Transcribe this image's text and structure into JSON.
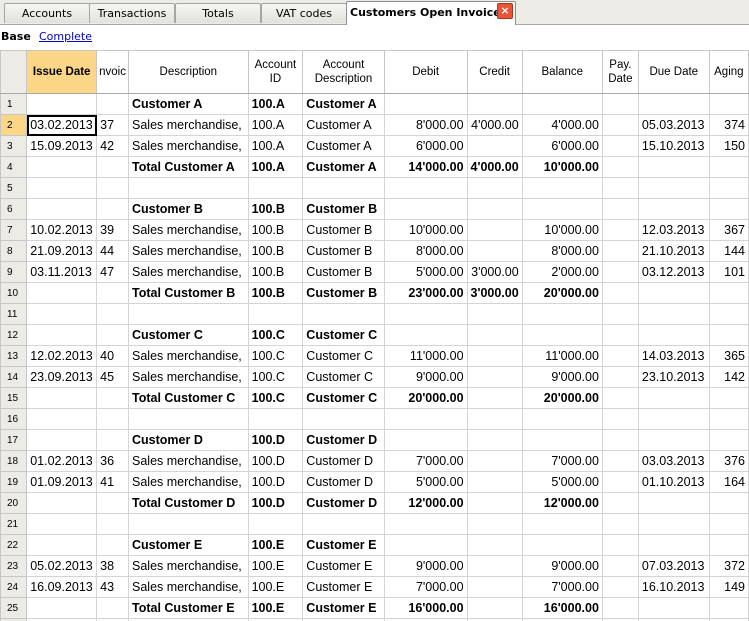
{
  "tabs": [
    {
      "label": "Accounts"
    },
    {
      "label": "Transactions"
    },
    {
      "label": "Totals"
    },
    {
      "label": "VAT codes"
    },
    {
      "label": "Customers Open Invoices",
      "close_glyph": "×"
    }
  ],
  "views": {
    "base": "Base",
    "complete": "Complete"
  },
  "columns": [
    "",
    "Issue Date",
    "nvoic",
    "Description",
    "Account ID",
    "Account Description",
    "Debit",
    "Credit",
    "Balance",
    "Pay. Date",
    "Due Date",
    "Aging"
  ],
  "rows": [
    [
      "1",
      "",
      "",
      "Customer A",
      "100.A",
      "Customer A",
      "",
      "",
      "",
      "",
      "",
      ""
    ],
    [
      "2",
      "03.02.2013",
      "37",
      "Sales merchandise,",
      "100.A",
      "Customer A",
      "8'000.00",
      "4'000.00",
      "4'000.00",
      "",
      "05.03.2013",
      "374"
    ],
    [
      "3",
      "15.09.2013",
      "42",
      "Sales merchandise,",
      "100.A",
      "Customer A",
      "6'000.00",
      "",
      "6'000.00",
      "",
      "15.10.2013",
      "150"
    ],
    [
      "4",
      "",
      "",
      "Total Customer A",
      "100.A",
      "Customer A",
      "14'000.00",
      "4'000.00",
      "10'000.00",
      "",
      "",
      ""
    ],
    [
      "5",
      "",
      "",
      "",
      "",
      "",
      "",
      "",
      "",
      "",
      "",
      ""
    ],
    [
      "6",
      "",
      "",
      "Customer B",
      "100.B",
      "Customer B",
      "",
      "",
      "",
      "",
      "",
      ""
    ],
    [
      "7",
      "10.02.2013",
      "39",
      "Sales merchandise,",
      "100.B",
      "Customer B",
      "10'000.00",
      "",
      "10'000.00",
      "",
      "12.03.2013",
      "367"
    ],
    [
      "8",
      "21.09.2013",
      "44",
      "Sales merchandise,",
      "100.B",
      "Customer B",
      "8'000.00",
      "",
      "8'000.00",
      "",
      "21.10.2013",
      "144"
    ],
    [
      "9",
      "03.11.2013",
      "47",
      "Sales merchandise,",
      "100.B",
      "Customer B",
      "5'000.00",
      "3'000.00",
      "2'000.00",
      "",
      "03.12.2013",
      "101"
    ],
    [
      "10",
      "",
      "",
      "Total Customer B",
      "100.B",
      "Customer B",
      "23'000.00",
      "3'000.00",
      "20'000.00",
      "",
      "",
      ""
    ],
    [
      "11",
      "",
      "",
      "",
      "",
      "",
      "",
      "",
      "",
      "",
      "",
      ""
    ],
    [
      "12",
      "",
      "",
      "Customer C",
      "100.C",
      "Customer C",
      "",
      "",
      "",
      "",
      "",
      ""
    ],
    [
      "13",
      "12.02.2013",
      "40",
      "Sales merchandise,",
      "100.C",
      "Customer C",
      "11'000.00",
      "",
      "11'000.00",
      "",
      "14.03.2013",
      "365"
    ],
    [
      "14",
      "23.09.2013",
      "45",
      "Sales merchandise,",
      "100.C",
      "Customer C",
      "9'000.00",
      "",
      "9'000.00",
      "",
      "23.10.2013",
      "142"
    ],
    [
      "15",
      "",
      "",
      "Total Customer C",
      "100.C",
      "Customer C",
      "20'000.00",
      "",
      "20'000.00",
      "",
      "",
      ""
    ],
    [
      "16",
      "",
      "",
      "",
      "",
      "",
      "",
      "",
      "",
      "",
      "",
      ""
    ],
    [
      "17",
      "",
      "",
      "Customer D",
      "100.D",
      "Customer D",
      "",
      "",
      "",
      "",
      "",
      ""
    ],
    [
      "18",
      "01.02.2013",
      "36",
      "Sales merchandise,",
      "100.D",
      "Customer D",
      "7'000.00",
      "",
      "7'000.00",
      "",
      "03.03.2013",
      "376"
    ],
    [
      "19",
      "01.09.2013",
      "41",
      "Sales merchandise,",
      "100.D",
      "Customer D",
      "5'000.00",
      "",
      "5'000.00",
      "",
      "01.10.2013",
      "164"
    ],
    [
      "20",
      "",
      "",
      "Total Customer D",
      "100.D",
      "Customer D",
      "12'000.00",
      "",
      "12'000.00",
      "",
      "",
      ""
    ],
    [
      "21",
      "",
      "",
      "",
      "",
      "",
      "",
      "",
      "",
      "",
      "",
      ""
    ],
    [
      "22",
      "",
      "",
      "Customer E",
      "100.E",
      "Customer E",
      "",
      "",
      "",
      "",
      "",
      ""
    ],
    [
      "23",
      "05.02.2013",
      "38",
      "Sales merchandise,",
      "100.E",
      "Customer E",
      "9'000.00",
      "",
      "9'000.00",
      "",
      "07.03.2013",
      "372"
    ],
    [
      "24",
      "16.09.2013",
      "43",
      "Sales merchandise,",
      "100.E",
      "Customer E",
      "7'000.00",
      "",
      "7'000.00",
      "",
      "16.10.2013",
      "149"
    ],
    [
      "25",
      "",
      "",
      "Total Customer E",
      "100.E",
      "Customer E",
      "16'000.00",
      "",
      "16'000.00",
      "",
      "",
      ""
    ],
    [
      "",
      "",
      "",
      "",
      "",
      "",
      "",
      "",
      "",
      "",
      "",
      ""
    ]
  ],
  "bold_rows": [
    0,
    3,
    5,
    9,
    11,
    14,
    16,
    19,
    21,
    24
  ],
  "selected_row": 1,
  "sorted_column": 1
}
